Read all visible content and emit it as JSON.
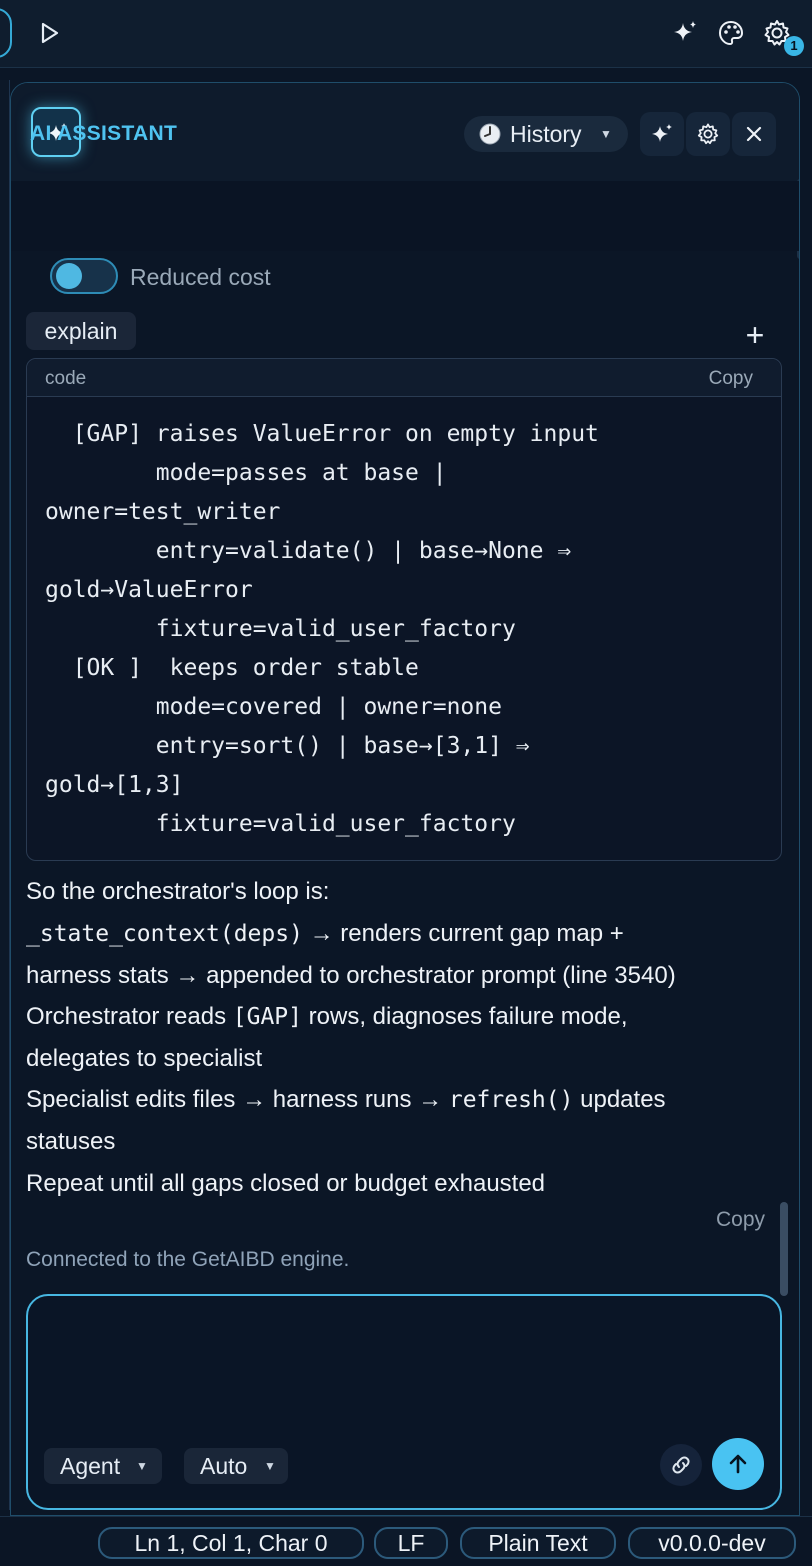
{
  "topbar": {
    "notification_count": "1"
  },
  "assistant": {
    "title": "AI ASSISTANT",
    "history_label": "History",
    "reduced_cost_label": "Reduced cost",
    "chip_label": "explain",
    "add_label": "+"
  },
  "code": {
    "lang": "code",
    "copy_label": "Copy",
    "lines": [
      "  [GAP] raises ValueError on empty input",
      "        mode=passes at base |",
      "owner=test_writer",
      "        entry=validate() | base→None ⇒",
      "gold→ValueError",
      "        fixture=valid_user_factory",
      "  [OK ]  keeps order stable",
      "        mode=covered | owner=none",
      "        entry=sort() | base→[3,1] ⇒",
      "gold→[1,3]",
      "        fixture=valid_user_factory"
    ]
  },
  "message": {
    "intro": "So the orchestrator's loop is:",
    "step1_code": "_state_context(deps)",
    "step1_text": " → renders current gap map +",
    "step1_cont": "harness stats → appended to orchestrator prompt (line 3540)",
    "step2_pre": "Orchestrator reads ",
    "step2_code": "[GAP]",
    "step2_post": " rows, diagnoses failure mode,",
    "step2_cont": "delegates to specialist",
    "step3_pre": "Specialist edits files → harness runs → ",
    "step3_code": "refresh()",
    "step3_post": " updates",
    "step3_cont": "statuses",
    "step4": "Repeat until all gaps closed or budget exhausted",
    "copy_label": "Copy"
  },
  "status_message": "Connected to the GetAIBD engine.",
  "composer": {
    "value": "",
    "mode_select": "Agent",
    "model_select": "Auto"
  },
  "statusbar": {
    "position": "Ln 1, Col 1, Char 0",
    "line_ending": "LF",
    "language": "Plain Text",
    "version": "v0.0.0-dev"
  },
  "colors": {
    "accent": "#4fc3f0",
    "background": "#0b1626",
    "send_button": "#49c3f2"
  }
}
